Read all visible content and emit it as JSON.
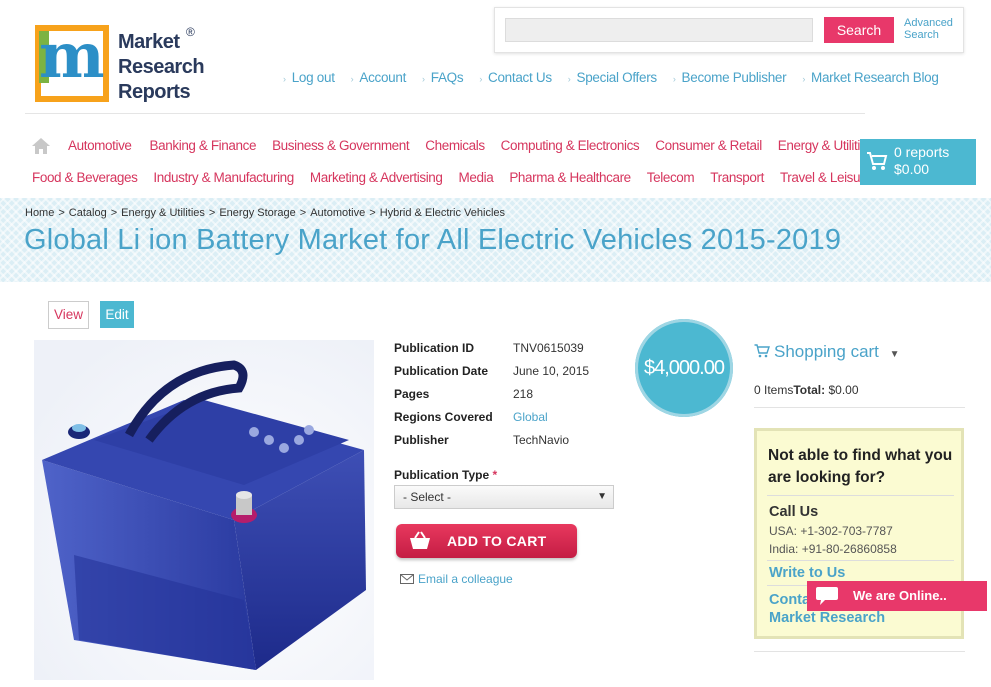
{
  "logo": {
    "line1": "Market",
    "line2": "Research",
    "line3": "Reports",
    "reg": "®"
  },
  "search": {
    "placeholder": "",
    "button_label": "Search",
    "advanced_line1": "Advanced",
    "advanced_line2": "Search"
  },
  "top_links": [
    "Log out",
    "Account",
    "FAQs",
    "Contact Us",
    "Special Offers",
    "Become Publisher",
    "Market Research Blog"
  ],
  "categories_row1": [
    "Automotive",
    "Banking & Finance",
    "Business & Government",
    "Chemicals",
    "Computing & Electronics",
    "Consumer & Retail",
    "Energy & Utilities"
  ],
  "categories_row2": [
    "Food & Beverages",
    "Industry & Manufacturing",
    "Marketing & Advertising",
    "Media",
    "Pharma & Healthcare",
    "Telecom",
    "Transport",
    "Travel & Leisure"
  ],
  "cart": {
    "reports": "0 reports",
    "total": "$0.00"
  },
  "breadcrumb": [
    "Home",
    "Catalog",
    "Energy & Utilities",
    "Energy Storage",
    "Automotive",
    "Hybrid & Electric Vehicles"
  ],
  "page_title": "Global Li ion Battery Market for All Electric Vehicles 2015-2019",
  "tabs": {
    "view": "View",
    "edit": "Edit"
  },
  "details": {
    "publication_id": {
      "label": "Publication ID",
      "value": "TNV0615039"
    },
    "publication_date": {
      "label": "Publication Date",
      "value": "June 10, 2015"
    },
    "pages": {
      "label": "Pages",
      "value": "218"
    },
    "regions": {
      "label": "Regions Covered",
      "value": "Global"
    },
    "publisher": {
      "label": "Publisher",
      "value": "TechNavio"
    }
  },
  "publication_type": {
    "label": "Publication Type",
    "required": "*",
    "selected": "- Select -"
  },
  "add_to_cart": "ADD TO CART",
  "email_colleague": "Email a colleague",
  "price": "$4,000.00",
  "shopping_cart": {
    "title": "Shopping cart",
    "items": "0 Items",
    "total_label": "Total:",
    "total_value": " $0.00"
  },
  "help": {
    "heading": "Not able to find what you are looking for?",
    "call_us": "Call Us",
    "usa_phone": "USA: +1-302-703-7787",
    "india_phone": "India: +91-80-26860858",
    "write_us": "Write to Us",
    "contact_line1": "Conta",
    "contact_line2": "Market Research"
  },
  "chat": {
    "label": "We are Online.."
  },
  "colors": {
    "accent_blue": "#4cb8d1",
    "link_blue": "#4aa3c9",
    "brand_red": "#d6365e",
    "button_red": "#e8386a"
  }
}
